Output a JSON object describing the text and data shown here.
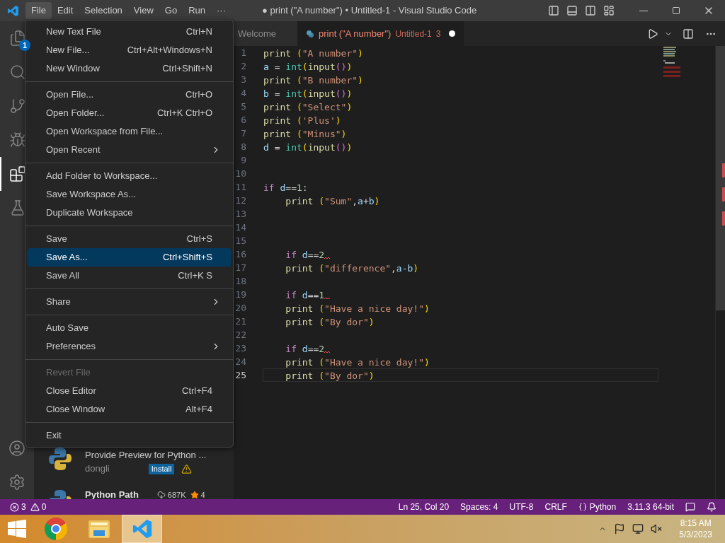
{
  "title_bar": {
    "menus": [
      {
        "label": "File",
        "selected": true
      },
      {
        "label": "Edit",
        "selected": false
      },
      {
        "label": "Selection",
        "selected": false
      },
      {
        "label": "View",
        "selected": false
      },
      {
        "label": "Go",
        "selected": false
      },
      {
        "label": "Run",
        "selected": false
      },
      {
        "label": "···",
        "selected": false
      }
    ],
    "title": "● print (\"A number\") • Untitled-1 - Visual Studio Code"
  },
  "activity_bar": {
    "items": [
      {
        "kind": "explorer",
        "badge": "1",
        "selected": false
      },
      {
        "kind": "search",
        "selected": false
      },
      {
        "kind": "source-control",
        "selected": false
      },
      {
        "kind": "run",
        "selected": false
      },
      {
        "kind": "extensions",
        "selected": true
      },
      {
        "kind": "testing",
        "selected": false
      }
    ]
  },
  "file_menu": {
    "groups": [
      {
        "items": [
          {
            "label": "New Text File",
            "shortcut": "Ctrl+N",
            "submenu": false,
            "selected": false,
            "disabled": false
          },
          {
            "label": "New File...",
            "shortcut": "Ctrl+Alt+Windows+N",
            "submenu": false,
            "selected": false,
            "disabled": false
          },
          {
            "label": "New Window",
            "shortcut": "Ctrl+Shift+N",
            "submenu": false,
            "selected": false,
            "disabled": false
          }
        ]
      },
      {
        "items": [
          {
            "label": "Open File...",
            "shortcut": "Ctrl+O",
            "submenu": false,
            "selected": false,
            "disabled": false
          },
          {
            "label": "Open Folder...",
            "shortcut": "Ctrl+K Ctrl+O",
            "submenu": false,
            "selected": false,
            "disabled": false
          },
          {
            "label": "Open Workspace from File...",
            "submenu": false,
            "selected": false,
            "disabled": false
          },
          {
            "label": "Open Recent",
            "submenu": true,
            "selected": false,
            "disabled": false
          }
        ]
      },
      {
        "items": [
          {
            "label": "Add Folder to Workspace...",
            "submenu": false,
            "selected": false,
            "disabled": false
          },
          {
            "label": "Save Workspace As...",
            "submenu": false,
            "selected": false,
            "disabled": false
          },
          {
            "label": "Duplicate Workspace",
            "submenu": false,
            "selected": false,
            "disabled": false
          }
        ]
      },
      {
        "items": [
          {
            "label": "Save",
            "shortcut": "Ctrl+S",
            "submenu": false,
            "selected": false,
            "disabled": false
          },
          {
            "label": "Save As...",
            "shortcut": "Ctrl+Shift+S",
            "submenu": false,
            "selected": true,
            "disabled": false
          },
          {
            "label": "Save All",
            "shortcut": "Ctrl+K S",
            "submenu": false,
            "selected": false,
            "disabled": false
          }
        ]
      },
      {
        "items": [
          {
            "label": "Share",
            "submenu": true,
            "selected": false,
            "disabled": false
          }
        ]
      },
      {
        "items": [
          {
            "label": "Auto Save",
            "submenu": false,
            "selected": false,
            "disabled": false
          },
          {
            "label": "Preferences",
            "submenu": true,
            "selected": false,
            "disabled": false
          }
        ]
      },
      {
        "items": [
          {
            "label": "Revert File",
            "submenu": false,
            "selected": false,
            "disabled": true
          },
          {
            "label": "Close Editor",
            "shortcut": "Ctrl+F4",
            "submenu": false,
            "selected": false,
            "disabled": false
          },
          {
            "label": "Close Window",
            "shortcut": "Alt+F4",
            "submenu": false,
            "selected": false,
            "disabled": false
          }
        ]
      },
      {
        "items": [
          {
            "label": "Exit",
            "submenu": false,
            "selected": false,
            "disabled": false
          }
        ]
      }
    ]
  },
  "sidebar": {
    "extensions": [
      {
        "description": "Provide Preview for Python ...",
        "publisher": "dongli",
        "button": "Install",
        "warning": true
      },
      {
        "name": "Python Path",
        "downloads": "687K",
        "rating": "4"
      }
    ]
  },
  "tabs": [
    {
      "title": "Welcome",
      "selected": false
    },
    {
      "title": "print (\"A number\")",
      "description": "Untitled-1",
      "problems": "3",
      "modified": true,
      "selected": true
    }
  ],
  "code_lines": [
    {
      "number": "1",
      "current": false,
      "error": false,
      "tokens": [
        {
          "text": "print ",
          "kind": "fn"
        },
        {
          "text": "(",
          "kind": "paren"
        },
        {
          "text": "\"A number\"",
          "kind": "str"
        },
        {
          "text": ")",
          "kind": "paren"
        }
      ]
    },
    {
      "number": "2",
      "current": false,
      "error": false,
      "tokens": [
        {
          "text": "a",
          "kind": "var"
        },
        {
          "text": " = ",
          "kind": "plain"
        },
        {
          "text": "int",
          "kind": "builtin"
        },
        {
          "text": "(",
          "kind": "paren"
        },
        {
          "text": "input",
          "kind": "fn"
        },
        {
          "text": "()",
          "kind": "paren2"
        },
        {
          "text": ")",
          "kind": "paren"
        }
      ]
    },
    {
      "number": "3",
      "current": false,
      "error": false,
      "tokens": [
        {
          "text": "print ",
          "kind": "fn"
        },
        {
          "text": "(",
          "kind": "paren"
        },
        {
          "text": "\"B number\"",
          "kind": "str"
        },
        {
          "text": ")",
          "kind": "paren"
        }
      ]
    },
    {
      "number": "4",
      "current": false,
      "error": false,
      "tokens": [
        {
          "text": "b",
          "kind": "var"
        },
        {
          "text": " = ",
          "kind": "plain"
        },
        {
          "text": "int",
          "kind": "builtin"
        },
        {
          "text": "(",
          "kind": "paren"
        },
        {
          "text": "input",
          "kind": "fn"
        },
        {
          "text": "()",
          "kind": "paren2"
        },
        {
          "text": ")",
          "kind": "paren"
        }
      ]
    },
    {
      "number": "5",
      "current": false,
      "error": false,
      "tokens": [
        {
          "text": "print ",
          "kind": "fn"
        },
        {
          "text": "(",
          "kind": "paren"
        },
        {
          "text": "\"Select\"",
          "kind": "str"
        },
        {
          "text": ")",
          "kind": "paren"
        }
      ]
    },
    {
      "number": "6",
      "current": false,
      "error": false,
      "tokens": [
        {
          "text": "print ",
          "kind": "fn"
        },
        {
          "text": "(",
          "kind": "paren"
        },
        {
          "text": "'Plus'",
          "kind": "str"
        },
        {
          "text": ")",
          "kind": "paren"
        }
      ]
    },
    {
      "number": "7",
      "current": false,
      "error": false,
      "tokens": [
        {
          "text": "print ",
          "kind": "fn"
        },
        {
          "text": "(",
          "kind": "paren"
        },
        {
          "text": "\"Minus\"",
          "kind": "str"
        },
        {
          "text": ")",
          "kind": "paren"
        }
      ]
    },
    {
      "number": "8",
      "current": false,
      "error": false,
      "tokens": [
        {
          "text": "d",
          "kind": "var"
        },
        {
          "text": " = ",
          "kind": "plain"
        },
        {
          "text": "int",
          "kind": "builtin"
        },
        {
          "text": "(",
          "kind": "paren"
        },
        {
          "text": "input",
          "kind": "fn"
        },
        {
          "text": "()",
          "kind": "paren2"
        },
        {
          "text": ")",
          "kind": "paren"
        }
      ]
    },
    {
      "number": "9",
      "current": false
    },
    {
      "number": "10",
      "current": false
    },
    {
      "number": "11",
      "current": false,
      "error": false,
      "tokens": [
        {
          "text": "if ",
          "kind": "kw"
        },
        {
          "text": "d",
          "kind": "var"
        },
        {
          "text": "==",
          "kind": "plain"
        },
        {
          "text": "1",
          "kind": "num"
        },
        {
          "text": ":",
          "kind": "plain"
        }
      ]
    },
    {
      "number": "12",
      "current": false,
      "error": false,
      "tokens": [
        {
          "text": "    print ",
          "kind": "fn"
        },
        {
          "text": "(",
          "kind": "paren"
        },
        {
          "text": "\"Sum\"",
          "kind": "str"
        },
        {
          "text": ",",
          "kind": "plain"
        },
        {
          "text": "a",
          "kind": "var"
        },
        {
          "text": "+",
          "kind": "plain"
        },
        {
          "text": "b",
          "kind": "var"
        },
        {
          "text": ")",
          "kind": "paren"
        }
      ]
    },
    {
      "number": "13",
      "current": false
    },
    {
      "number": "14",
      "current": false
    },
    {
      "number": "15",
      "current": false
    },
    {
      "number": "16",
      "current": false,
      "error": true,
      "tokens": [
        {
          "text": "    if ",
          "kind": "kw"
        },
        {
          "text": "d",
          "kind": "var"
        },
        {
          "text": "==",
          "kind": "plain"
        },
        {
          "text": "2",
          "kind": "num"
        }
      ]
    },
    {
      "number": "17",
      "current": false,
      "error": false,
      "tokens": [
        {
          "text": "    print ",
          "kind": "fn"
        },
        {
          "text": "(",
          "kind": "paren"
        },
        {
          "text": "\"difference\"",
          "kind": "str"
        },
        {
          "text": ",",
          "kind": "plain"
        },
        {
          "text": "a",
          "kind": "var"
        },
        {
          "text": "-",
          "kind": "plain"
        },
        {
          "text": "b",
          "kind": "var"
        },
        {
          "text": ")",
          "kind": "paren"
        }
      ]
    },
    {
      "number": "18",
      "current": false
    },
    {
      "number": "19",
      "current": false,
      "error": true,
      "tokens": [
        {
          "text": "    if ",
          "kind": "kw"
        },
        {
          "text": "d",
          "kind": "var"
        },
        {
          "text": "==",
          "kind": "plain"
        },
        {
          "text": "1",
          "kind": "num"
        }
      ]
    },
    {
      "number": "20",
      "current": false,
      "error": false,
      "tokens": [
        {
          "text": "    print ",
          "kind": "fn"
        },
        {
          "text": "(",
          "kind": "paren"
        },
        {
          "text": "\"Have a nice day!\"",
          "kind": "str"
        },
        {
          "text": ")",
          "kind": "paren"
        }
      ]
    },
    {
      "number": "21",
      "current": false,
      "error": false,
      "tokens": [
        {
          "text": "    print ",
          "kind": "fn"
        },
        {
          "text": "(",
          "kind": "paren"
        },
        {
          "text": "\"By dor\"",
          "kind": "str"
        },
        {
          "text": ")",
          "kind": "paren"
        }
      ]
    },
    {
      "number": "22",
      "current": false
    },
    {
      "number": "23",
      "current": false,
      "error": true,
      "tokens": [
        {
          "text": "    if ",
          "kind": "kw"
        },
        {
          "text": "d",
          "kind": "var"
        },
        {
          "text": "==",
          "kind": "plain"
        },
        {
          "text": "2",
          "kind": "num"
        }
      ]
    },
    {
      "number": "24",
      "current": false,
      "error": false,
      "tokens": [
        {
          "text": "    print ",
          "kind": "fn"
        },
        {
          "text": "(",
          "kind": "paren"
        },
        {
          "text": "\"Have a nice day!\"",
          "kind": "str"
        },
        {
          "text": ")",
          "kind": "paren"
        }
      ]
    },
    {
      "number": "25",
      "current": true,
      "error": false,
      "tokens": [
        {
          "text": "    print ",
          "kind": "fn"
        },
        {
          "text": "(",
          "kind": "paren"
        },
        {
          "text": "\"By dor\"",
          "kind": "str"
        },
        {
          "text": ")",
          "kind": "paren"
        }
      ]
    }
  ],
  "status_bar": {
    "errors": "3",
    "warnings": "0",
    "items": [
      {
        "text": "Ln 25, Col 20",
        "kind": "text"
      },
      {
        "text": "Spaces: 4",
        "kind": "text"
      },
      {
        "text": "UTF-8",
        "kind": "text"
      },
      {
        "text": "CRLF",
        "kind": "text"
      },
      {
        "text": "Python",
        "kind": "language"
      },
      {
        "text": "3.11.3 64-bit",
        "kind": "text"
      }
    ]
  },
  "taskbar": {
    "apps": [
      {
        "kind": "chrome",
        "selected": false
      },
      {
        "kind": "file-explorer",
        "selected": false
      },
      {
        "kind": "vscode",
        "selected": true
      }
    ],
    "time": "8:15 AM",
    "date": "5/3/2023"
  }
}
